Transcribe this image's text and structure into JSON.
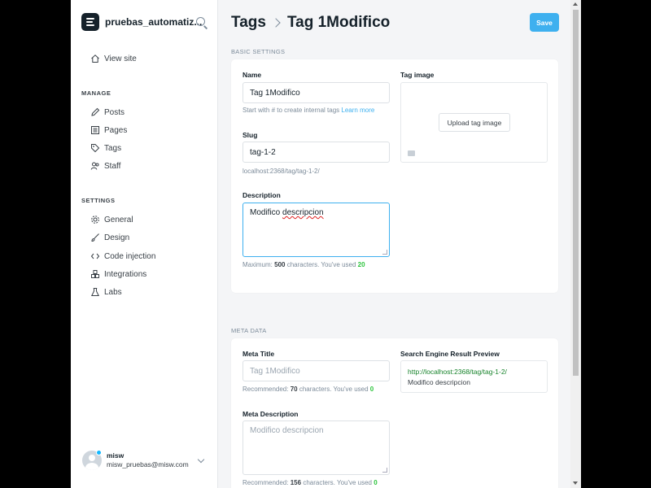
{
  "sidebar": {
    "site_name": "pruebas_automatiz...",
    "view_site": "View site",
    "manage_header": "MANAGE",
    "manage_items": [
      "Posts",
      "Pages",
      "Tags",
      "Staff"
    ],
    "settings_header": "SETTINGS",
    "settings_items": [
      "General",
      "Design",
      "Code injection",
      "Integrations",
      "Labs"
    ],
    "user": {
      "name": "misw",
      "email": "misw_pruebas@misw.com"
    }
  },
  "header": {
    "breadcrumb_root": "Tags",
    "breadcrumb_current": "Tag 1Modifico",
    "save_label": "Save"
  },
  "basic": {
    "section_label": "BASIC SETTINGS",
    "name_label": "Name",
    "name_value": "Tag 1Modifico",
    "name_hint": "Start with # to create internal tags",
    "name_hint_link": "Learn more",
    "slug_label": "Slug",
    "slug_value": "tag-1-2",
    "slug_url": "localhost:2368/tag/tag-1-2/",
    "description_label": "Description",
    "description_value": "Modifico descripcion",
    "desc_hint_prefix": "Maximum:",
    "desc_hint_max": "500",
    "desc_hint_mid": "characters. You've used",
    "desc_hint_used": "20",
    "tag_image_label": "Tag image",
    "upload_label": "Upload tag image"
  },
  "meta": {
    "section_label": "META DATA",
    "title_label": "Meta Title",
    "title_placeholder": "Tag 1Modifico",
    "title_hint_prefix": "Recommended:",
    "title_hint_max": "70",
    "title_hint_mid": "characters. You've used",
    "title_hint_used": "0",
    "serp_label": "Search Engine Result Preview",
    "serp_url": "http://localhost:2368/tag/tag-1-2/",
    "serp_desc": "Modifico descripcion",
    "desc_label": "Meta Description",
    "desc_placeholder": "Modifico descripcion",
    "desc_hint_prefix": "Recommended:",
    "desc_hint_max": "156",
    "desc_hint_mid": "characters. You've used",
    "desc_hint_used": "0"
  },
  "colors": {
    "accent": "#3eb0ef",
    "green": "#2dc43d",
    "text": "#15212a"
  }
}
